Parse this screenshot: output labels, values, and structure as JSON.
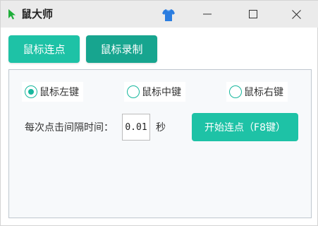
{
  "window": {
    "title": "鼠大师"
  },
  "toolbar": {
    "tabs": [
      {
        "label": "鼠标连点"
      },
      {
        "label": "鼠标录制"
      }
    ]
  },
  "mouse_buttons": {
    "options": [
      {
        "label": "鼠标左键",
        "selected": true
      },
      {
        "label": "鼠标中键",
        "selected": false
      },
      {
        "label": "鼠标右键",
        "selected": false
      }
    ]
  },
  "interval": {
    "label": "每次点击间隔时间：",
    "value": "0.01",
    "unit": "秒"
  },
  "start_button": {
    "label": "开始连点（F8键）"
  },
  "colors": {
    "accent": "#1ec2a6",
    "accent_dark": "#17a58f",
    "title_bar": "#ebebeb",
    "panel_bg": "#f7f9fb"
  },
  "icons": {
    "app": "green-cursor-icon",
    "skin": "shirt-icon",
    "minimize": "minimize-icon",
    "maximize": "maximize-icon",
    "close": "close-icon"
  }
}
